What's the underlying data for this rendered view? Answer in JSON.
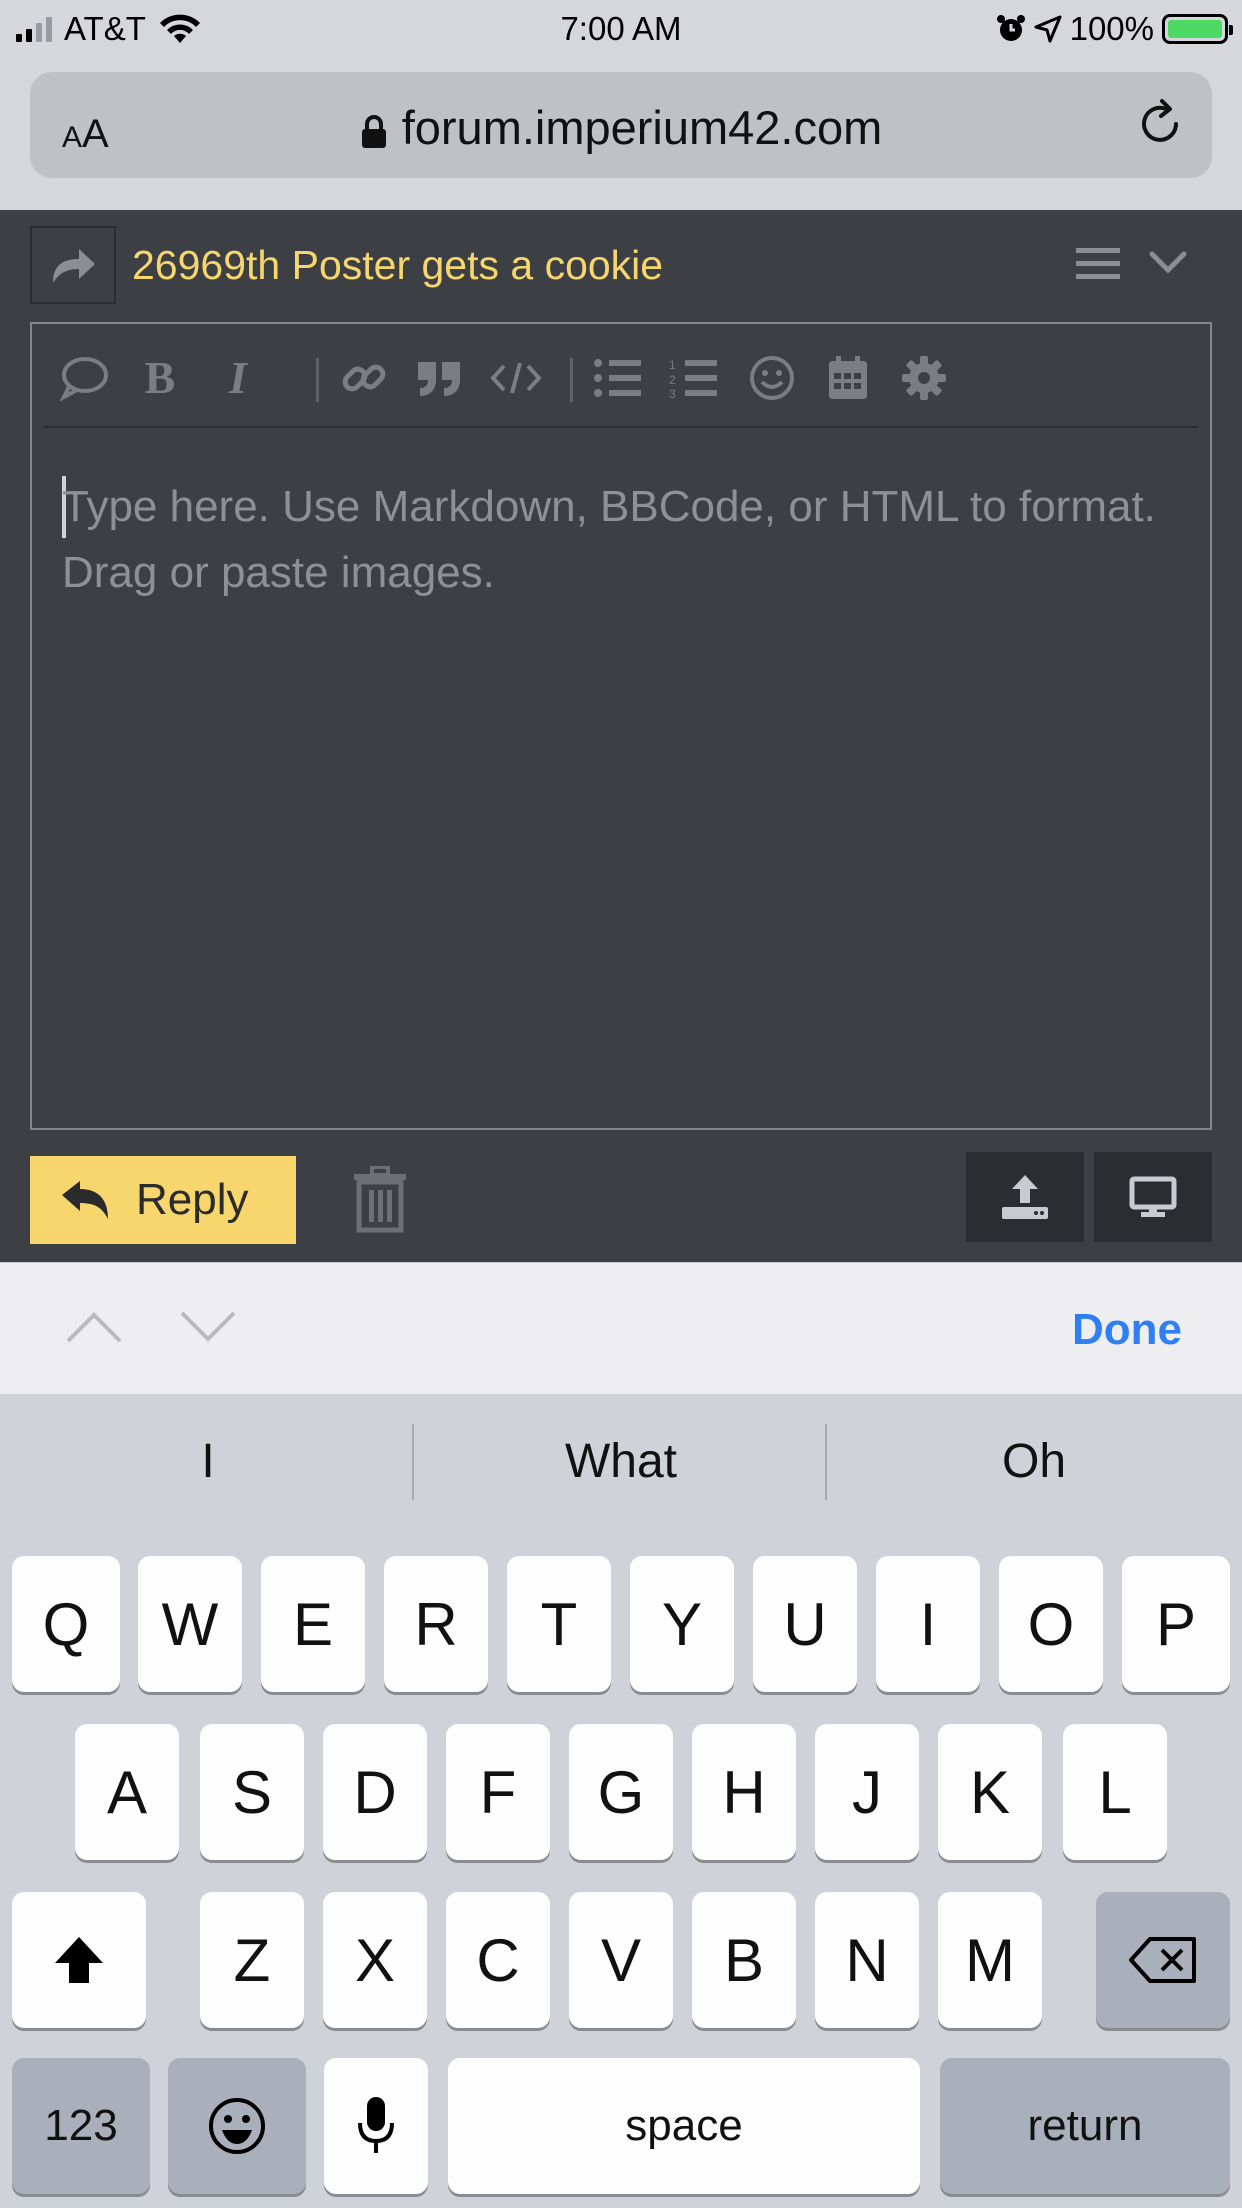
{
  "status": {
    "carrier": "AT&T",
    "time": "7:00 AM",
    "battery": "100%",
    "battery_level": 1.0
  },
  "browser": {
    "aa": "AA",
    "url": "forum.imperium42.com"
  },
  "composer": {
    "topic_title": "26969th Poster gets a cookie",
    "placeholder": "Type here. Use Markdown, BBCode, or HTML to format. Drag or paste images.",
    "toolbar_icons": [
      "quote-bubble-icon",
      "bold-icon",
      "italic-icon",
      "link-icon",
      "blockquote-icon",
      "code-icon",
      "bullet-list-icon",
      "numbered-list-icon",
      "emoji-icon",
      "calendar-icon",
      "gear-icon"
    ],
    "reply_label": "Reply"
  },
  "accessory": {
    "done_label": "Done"
  },
  "keyboard": {
    "suggestions": [
      "I",
      "What",
      "Oh"
    ],
    "row1": [
      "Q",
      "W",
      "E",
      "R",
      "T",
      "Y",
      "U",
      "I",
      "O",
      "P"
    ],
    "row2": [
      "A",
      "S",
      "D",
      "F",
      "G",
      "H",
      "J",
      "K",
      "L"
    ],
    "row3": [
      "Z",
      "X",
      "C",
      "V",
      "B",
      "N",
      "M"
    ],
    "numbers_label": "123",
    "space_label": "space",
    "return_label": "return"
  }
}
